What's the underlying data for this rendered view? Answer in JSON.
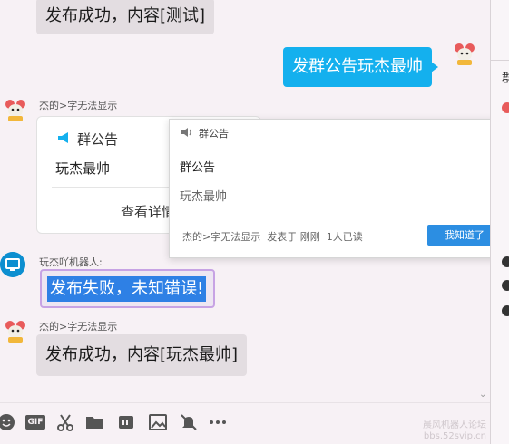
{
  "messages": {
    "top_bubble": "发布成功，内容[测试]",
    "sent_bubble": "发群公告玩杰最帅",
    "sender1": "杰的>字无法显示",
    "sender2": "玩杰吖机器人:",
    "fail_text": "发布失败，未知错误!",
    "sender3": "杰的>字无法显示",
    "bottom_bubble": "发布成功，内容[玩杰最帅]"
  },
  "group_card": {
    "title": "群公告",
    "content": "玩杰最帅",
    "link": "查看详情"
  },
  "popup": {
    "header": "群公告",
    "title": "群公告",
    "content": "玩杰最帅",
    "author": "杰的>字无法显示",
    "posted": "发表于 刚刚",
    "read": "1人已读",
    "button": "我知道了"
  },
  "right_panel": {
    "fragment": "群"
  },
  "watermark": {
    "line1": "晨风机器人论坛",
    "line2": "bbs.52svip.cn"
  },
  "toolbar": {
    "gif": "GIF",
    "icons": [
      "emoji-icon",
      "gif-icon",
      "scissors-icon",
      "folder-icon",
      "quote-icon",
      "image-icon",
      "mute-bell-icon",
      "more-icon"
    ]
  },
  "colors": {
    "blue_bubble": "#14b0ee",
    "gray_bubble": "#e3dde1",
    "button_blue": "#2c8ee2",
    "selection": "#2e80e5"
  }
}
